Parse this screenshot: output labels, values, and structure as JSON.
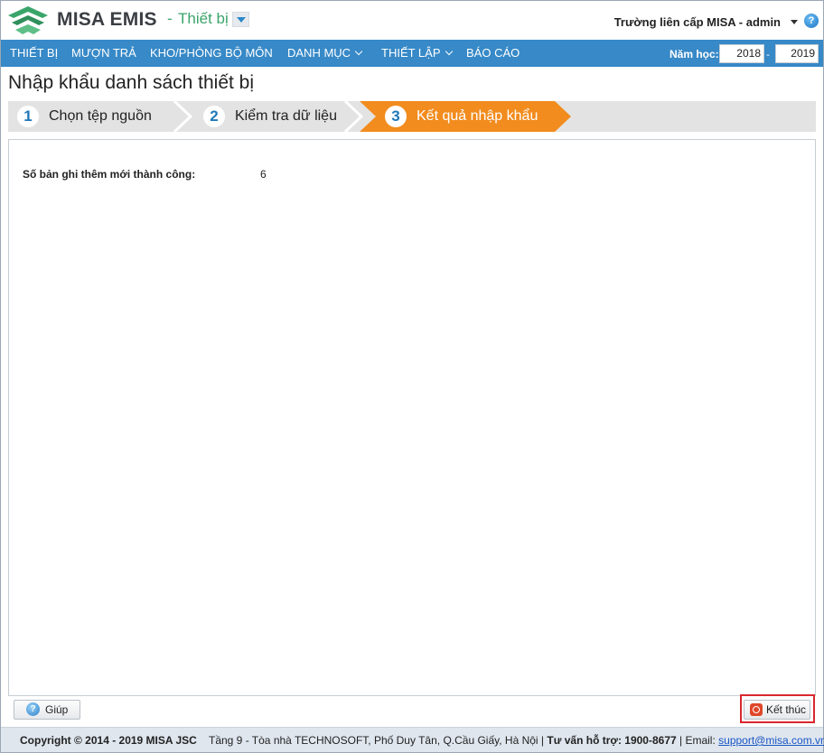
{
  "header": {
    "brand": "MISA EMIS",
    "separator": "-",
    "module": "Thiết bị",
    "user": "Trường liên cấp MISA - admin",
    "help_glyph": "?"
  },
  "nav": {
    "items": [
      {
        "label": "THIẾT BỊ",
        "has_menu": false
      },
      {
        "label": "MƯỢN TRẢ",
        "has_menu": false
      },
      {
        "label": "KHO/PHÒNG BỘ MÔN",
        "has_menu": false
      },
      {
        "label": "DANH MỤC",
        "has_menu": true
      },
      {
        "label": "THIẾT LẬP",
        "has_menu": true
      },
      {
        "label": "BÁO CÁO",
        "has_menu": false
      }
    ],
    "year_label": "Năm học:",
    "year_from": "2018",
    "year_dash": "-",
    "year_to": "2019"
  },
  "page": {
    "title": "Nhập khẩu danh sách thiết bị"
  },
  "steps": [
    {
      "num": "1",
      "label": "Chọn tệp nguồn",
      "active": false
    },
    {
      "num": "2",
      "label": "Kiểm tra dữ liệu",
      "active": false
    },
    {
      "num": "3",
      "label": "Kết quả nhập khẩu",
      "active": true
    }
  ],
  "result": {
    "label": "Số bản ghi thêm mới thành công:",
    "value": "6"
  },
  "buttons": {
    "help": "Giúp",
    "end": "Kết thúc"
  },
  "footer": {
    "copyright": "Copyright © 2014 - 2019 MISA JSC",
    "address": "Tầng 9 - Tòa nhà TECHNOSOFT, Phố Duy Tân, Q.Cầu Giấy, Hà Nội |",
    "hotline": "Tư vấn hỗ trợ: 1900-8677",
    "email_label": "| Email:",
    "email": "support@misa.com.vn"
  },
  "colors": {
    "nav_bg": "#3789c7",
    "step_active": "#f28c1e",
    "step_inactive": "#e3e3e3",
    "brand_green": "#3aa56a",
    "highlight_red": "#d9272e"
  }
}
